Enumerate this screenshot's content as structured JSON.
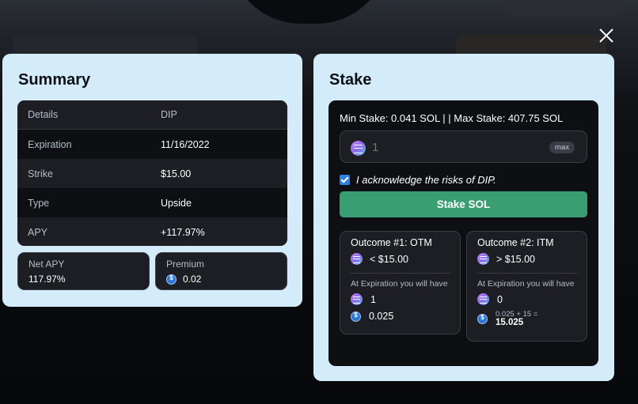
{
  "summary": {
    "title": "Summary",
    "rows": [
      {
        "label": "Details",
        "value": "DIP"
      },
      {
        "label": "Expiration",
        "value": "11/16/2022"
      },
      {
        "label": "Strike",
        "value": "$15.00"
      },
      {
        "label": "Type",
        "value": "Upside"
      },
      {
        "label": "APY",
        "value": "+117.97%"
      }
    ],
    "net_apy": {
      "label": "Net APY",
      "value": "117.97%"
    },
    "premium": {
      "label": "Premium",
      "value": "0.02",
      "icon": "usdc-icon"
    }
  },
  "stake": {
    "title": "Stake",
    "limits": "Min Stake: 0.041 SOL | | Max Stake: 407.75 SOL",
    "amount": {
      "value": "",
      "placeholder": "1",
      "icon": "sol-icon"
    },
    "max_label": "max",
    "acknowledge": {
      "checked": true,
      "text": "I acknowledge the risks of DIP."
    },
    "button_label": "Stake SOL",
    "outcomes": [
      {
        "title": "Outcome #1: OTM",
        "condition": "< $15.00",
        "note": "At Expiration you will have",
        "sol_amount": "1",
        "usdc_amount": "0.025"
      },
      {
        "title": "Outcome #2: ITM",
        "condition": "> $15.00",
        "note": "At Expiration you will have",
        "sol_amount": "0",
        "usdc_formula": "0.025 + 15 =",
        "usdc_amount": "15.025"
      }
    ]
  },
  "colors": {
    "panel_bg": "#d4ecf9",
    "card_dark": "#0d0f13",
    "card_mid": "#1c1e24",
    "accent_green": "#3a9e73",
    "checkbox_blue": "#2e7ee6"
  },
  "close_icon": "close-icon"
}
